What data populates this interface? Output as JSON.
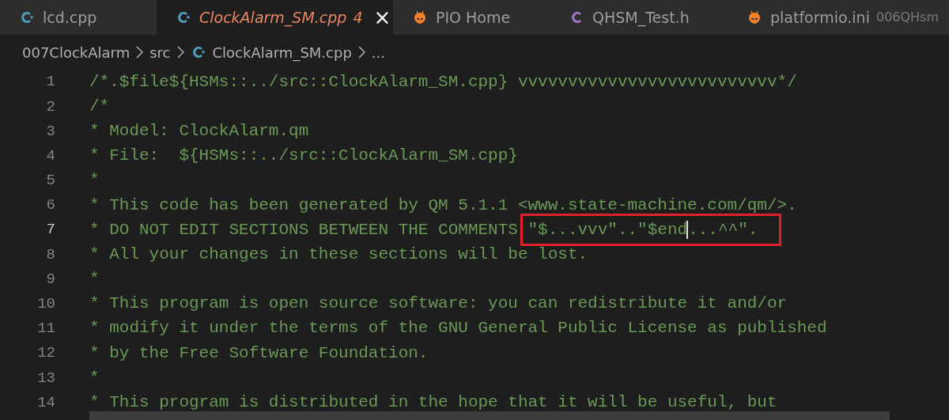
{
  "tabs": [
    {
      "label": "lcd.cpp",
      "kind": "cpp",
      "selected": false
    },
    {
      "label": "ClockAlarm_SM.cpp",
      "kind": "cpp",
      "selected": true,
      "problems": "4",
      "close": "×"
    },
    {
      "label": "PIO Home",
      "kind": "platformio",
      "selected": false
    },
    {
      "label": "QHSM_Test.h",
      "kind": "c",
      "selected": false
    },
    {
      "label": "platformio.ini",
      "kind": "platformio",
      "selected": false,
      "description": "006QHsm"
    }
  ],
  "breadcrumb": [
    {
      "label": "007ClockAlarm",
      "kind": "folder"
    },
    {
      "label": "src",
      "kind": "folder"
    },
    {
      "label": "ClockAlarm_SM.cpp",
      "kind": "cpp"
    },
    {
      "label": "...",
      "kind": "more"
    }
  ],
  "lines": [
    {
      "number": "1",
      "text": "/*.$file${HSMs::../src::ClockAlarm_SM.cpp} vvvvvvvvvvvvvvvvvvvvvvvvvv*/",
      "current": false
    },
    {
      "number": "2",
      "text": "/*",
      "current": false
    },
    {
      "number": "3",
      "text": "* Model: ClockAlarm.qm",
      "current": false
    },
    {
      "number": "4",
      "text": "* File:  ${HSMs::../src::ClockAlarm_SM.cpp}",
      "current": false
    },
    {
      "number": "5",
      "text": "*",
      "current": false
    },
    {
      "number": "6",
      "text": "* This code has been generated by QM 5.1.1 <www.state-machine.com/qm/>.",
      "current": false
    },
    {
      "number": "7",
      "text": "* DO NOT EDIT SECTIONS BETWEEN THE COMMENTS ",
      "boxed": [
        "\"$...vvv\"..\"$end",
        "...^^\"."
      ],
      "caret": true,
      "current": true
    },
    {
      "number": "8",
      "text": "* All your changes in these sections will be lost.",
      "current": false
    },
    {
      "number": "9",
      "text": "*",
      "current": false
    },
    {
      "number": "10",
      "text": "* This program is open source software: you can redistribute it and/or",
      "current": false
    },
    {
      "number": "11",
      "text": "* modify it under the terms of the GNU General Public License as published",
      "current": false
    },
    {
      "number": "12",
      "text": "* by the Free Software Foundation.",
      "current": false
    },
    {
      "number": "13",
      "text": "*",
      "current": false
    },
    {
      "number": "14",
      "text": "* This program is distributed in the hope that it will be useful, but",
      "current": false
    }
  ]
}
